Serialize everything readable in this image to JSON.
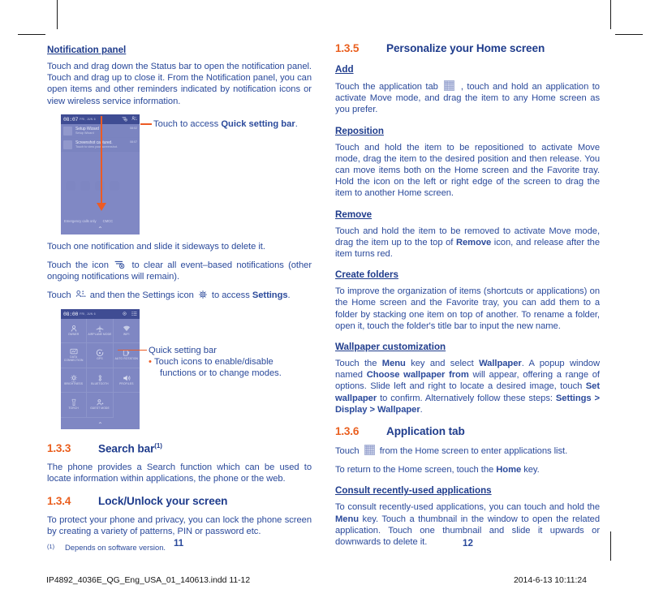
{
  "document": {
    "page_numbers": {
      "left": "11",
      "right": "12"
    },
    "footer": {
      "file": "IP4892_4036E_QG_Eng_USA_01_140613.indd   11-12",
      "timestamp": "2014-6-13   10:11:24"
    },
    "colors": {
      "heading_blue": "#1f3c8c",
      "body_blue": "#2b4a9b",
      "accent_orange": "#ea6020",
      "phone_bg": "#8088c4",
      "status_bar": "#3f4c93"
    }
  },
  "left_column": {
    "notification_panel": {
      "heading": "Notification panel",
      "paragraph": "Touch and drag down the Status bar to open the notification panel. Touch and drag up to close it. From the Notification panel, you can open items and other reminders indicated by notification icons or view wireless service information."
    },
    "phone_notification": {
      "status_time": "08:07",
      "status_date": "FRI, JUN 6",
      "icons": [
        "clear-all-icon",
        "quick-settings-icon"
      ],
      "notifications": [
        {
          "title": "Setup Wizard",
          "subtitle": "Setup Wizard",
          "time": "08:02"
        },
        {
          "title": "Screenshot captured.",
          "subtitle": "Touch to view your screenshot.",
          "time": "08:07"
        }
      ],
      "footer_left": "Emergency calls only",
      "footer_right": "CMCC"
    },
    "callout_top": {
      "prefix": "Touch to access ",
      "bold": "Quick setting bar",
      "suffix": "."
    },
    "after_image_paragraphs": [
      "Touch one notification and slide it sideways to delete it."
    ],
    "clear_all_sentence": {
      "before": "Touch the icon ",
      "after": " to clear all event–based notifications (other ongoing notifications will remain)."
    },
    "settings_sentence": {
      "p1": "Touch ",
      "p2": " and then the Settings icon ",
      "p3": " to access ",
      "bold": "Settings",
      "p4": "."
    },
    "phone_quicksettings": {
      "status_time": "08:00",
      "status_date": "FRI, JUN 6",
      "icons": [
        "gear-icon",
        "list-icon"
      ],
      "tiles": [
        {
          "label": "OWNER",
          "icon": "owner-icon"
        },
        {
          "label": "AIRPLANE MODE",
          "icon": "airplane-icon"
        },
        {
          "label": "WIFI",
          "icon": "wifi-icon"
        },
        {
          "label": "DATA CONNECTION",
          "icon": "data-connection-icon"
        },
        {
          "label": "GPS",
          "icon": "gps-icon"
        },
        {
          "label": "AUTO ROTATION",
          "icon": "auto-rotation-icon"
        },
        {
          "label": "BRIGHTNESS",
          "icon": "brightness-icon"
        },
        {
          "label": "BLUETOOTH",
          "icon": "bluetooth-icon"
        },
        {
          "label": "PROFILES",
          "icon": "profiles-icon"
        },
        {
          "label": "TORCH",
          "icon": "torch-icon"
        },
        {
          "label": "GUEST MODE",
          "icon": "guest-mode-icon"
        }
      ]
    },
    "callout_quicksetting": {
      "title": "Quick setting bar",
      "bullet": "Touch icons to enable/disable",
      "bullet_cont": "functions or to change modes."
    },
    "section_133": {
      "number": "1.3.3",
      "title": "Search bar",
      "footnote_marker": "(1)",
      "paragraph": "The phone provides a Search function which can be used to locate information within applications, the phone or the web."
    },
    "section_134": {
      "number": "1.3.4",
      "title": "Lock/Unlock your screen",
      "paragraph": "To protect your phone and privacy, you can lock the phone screen by creating a variety of patterns, PIN or password etc."
    },
    "footnote": {
      "marker": "(1)",
      "text": "Depends on software version."
    }
  },
  "right_column": {
    "section_135": {
      "number": "1.3.5",
      "title": "Personalize your Home screen"
    },
    "add": {
      "heading": "Add",
      "p_before": "Touch the application tab ",
      "p_after": " , touch and hold an application to activate Move mode, and drag the item to any Home screen as you prefer."
    },
    "reposition": {
      "heading": "Reposition",
      "paragraph": "Touch and hold the item to be repositioned to activate Move mode, drag the item to the desired position and then release. You can move items both on the Home screen and the Favorite tray. Hold the icon on the left or right edge of the screen to drag the item to another Home screen."
    },
    "remove": {
      "heading": "Remove",
      "p1": "Touch and hold the item to be removed to activate Move mode, drag the item up to the top of ",
      "bold": "Remove",
      "p2": " icon, and release after the item turns red."
    },
    "create_folders": {
      "heading": "Create folders",
      "paragraph": "To improve the organization of items (shortcuts or applications) on the Home screen and the Favorite tray, you can add them to a folder by stacking one item on top of another. To rename a folder, open it, touch the folder's title bar to input the new name."
    },
    "wallpaper": {
      "heading": "Wallpaper customization",
      "t1": "Touch the ",
      "b1": "Menu",
      "t2": " key and select ",
      "b2": "Wallpaper",
      "t3": ". A popup window named ",
      "b3": "Choose wallpaper from",
      "t4": " will appear, offering a range of options. Slide left and right to locate a desired image, touch ",
      "b4": "Set wallpaper",
      "t5": " to confirm. Alternatively follow these steps: ",
      "b5": "Settings > Display > Wallpaper",
      "t6": "."
    },
    "section_136": {
      "number": "1.3.6",
      "title": "Application tab",
      "p_before": "Touch ",
      "p_after": " from the Home screen to enter applications list.",
      "home_before": "To return to the Home screen, touch the ",
      "home_bold": "Home",
      "home_after": " key."
    },
    "consult": {
      "heading": "Consult recently-used applications",
      "t1": "To consult recently-used applications, you can touch and hold the ",
      "b1": "Menu",
      "t2": " key. Touch a thumbnail in the window to open the related application. Touch one thumbnail and slide it upwards or downwards to delete it."
    }
  }
}
